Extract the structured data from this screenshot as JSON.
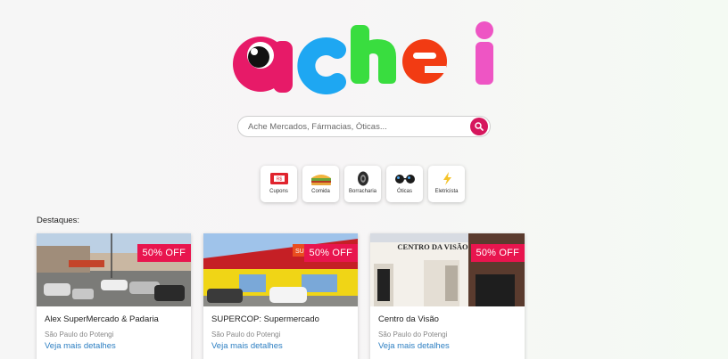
{
  "logo": {
    "text": "achei",
    "colors": [
      "#e71a68",
      "#1ea7f2",
      "#39dd3f",
      "#f23b13",
      "#ee55c4"
    ]
  },
  "search": {
    "placeholder": "Ache Mercados, Fármacias, Óticas...",
    "button_color": "#d6175d",
    "icon": "search-icon"
  },
  "categories": [
    {
      "label": "Cupons",
      "icon": "coupon-icon"
    },
    {
      "label": "Comida",
      "icon": "sandwich-icon"
    },
    {
      "label": "Borracharia",
      "icon": "tire-icon"
    },
    {
      "label": "Óticas",
      "icon": "glasses-icon"
    },
    {
      "label": "Eletricista",
      "icon": "lightning-icon"
    }
  ],
  "featured": {
    "title": "Destaques:",
    "cards": [
      {
        "name": "Alex SuperMercado & Padaria",
        "city": "São Paulo do Potengi",
        "link": "Veja mais detalhes",
        "badge": "50% OFF"
      },
      {
        "name": "SUPERCOP: Supermercado",
        "city": "São Paulo do Potengi",
        "link": "Veja mais detalhes",
        "badge": "50% OFF"
      },
      {
        "name": "Centro da Visão",
        "city": "São Paulo do Potengi",
        "link": "Veja mais detalhes",
        "badge": "50% OFF"
      }
    ]
  },
  "store_signs": {
    "card3_sign": "CENTRO DA VISÃO",
    "card2_sign": "SUPER"
  },
  "accent_color": "#e8154e",
  "link_color": "#2d7fc2"
}
